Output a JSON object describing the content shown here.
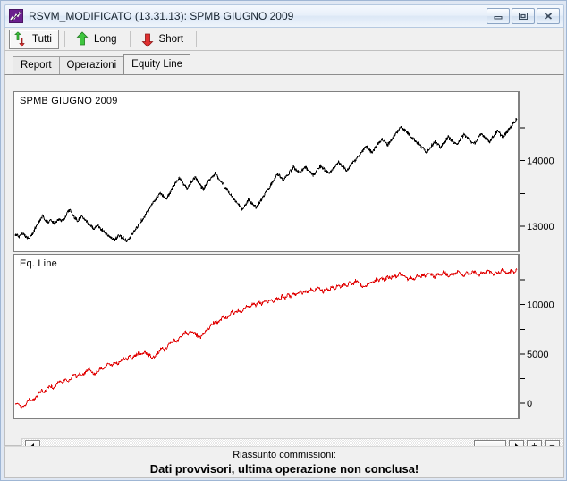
{
  "window": {
    "title": "RSVM_MODIFICATO (13.31.13): SPMB GIUGNO 2009",
    "app_icon": "line-chart-icon",
    "controls": {
      "minimize": "minimize-icon",
      "restore": "restore-icon",
      "close": "close-icon"
    }
  },
  "toolbar": {
    "buttons": [
      {
        "label": "Tutti",
        "icon": "up-down-arrow-icon",
        "active": true
      },
      {
        "label": "Long",
        "icon": "green-up-arrow-icon",
        "active": false
      },
      {
        "label": "Short",
        "icon": "red-down-arrow-icon",
        "active": false
      }
    ]
  },
  "tabs": [
    {
      "label": "Report",
      "selected": false
    },
    {
      "label": "Operazioni",
      "selected": false
    },
    {
      "label": "Equity Line",
      "selected": true
    }
  ],
  "scrollbar": {
    "left_arrow": "left-arrow-icon",
    "right_arrow": "right-arrow-icon",
    "zoom_in": "+",
    "zoom_out": "−"
  },
  "status": {
    "line1": "Riassunto commissioni:",
    "line2": "Dati provvisori, ultima operazione non conclusa!"
  },
  "colors": {
    "price_series": "#000000",
    "equity_series": "#e00000",
    "panel_bg": "#ffffff",
    "window_chrome": "#f0f0f0",
    "titlebar": "#e8f0fa"
  },
  "chart_data": [
    {
      "type": "line",
      "name": "price-chart",
      "title": "SPMB GIUGNO 2009",
      "xlabel": "",
      "ylabel": "",
      "ylim": [
        12700,
        14800
      ],
      "yticks": [
        13000,
        13500,
        14000,
        14500
      ],
      "ytick_labels": [
        "13000",
        "",
        "14000",
        ""
      ],
      "grid": false,
      "legend": "none",
      "series": [
        {
          "name": "SPMB GIUGNO 2009",
          "color": "#000000",
          "values": [
            12870,
            12860,
            12845,
            12880,
            12900,
            12855,
            12830,
            12815,
            12840,
            12900,
            12960,
            13010,
            13060,
            13110,
            13150,
            13120,
            13080,
            13060,
            13090,
            13070,
            13050,
            13080,
            13110,
            13100,
            13090,
            13120,
            13160,
            13220,
            13270,
            13180,
            13140,
            13110,
            13090,
            13120,
            13150,
            13110,
            13080,
            13050,
            13020,
            12990,
            12960,
            13000,
            13020,
            12980,
            12950,
            12930,
            12900,
            12870,
            12845,
            12820,
            12800,
            12790,
            12830,
            12860,
            12840,
            12820,
            12800,
            12780,
            12800,
            12850,
            12890,
            12930,
            12980,
            13020,
            13070,
            13110,
            13150,
            13200,
            13240,
            13290,
            13340,
            13380,
            13420,
            13470,
            13510,
            13480,
            13440,
            13400,
            13460,
            13510,
            13570,
            13620,
            13660,
            13700,
            13740,
            13690,
            13640,
            13600,
            13570,
            13620,
            13680,
            13720,
            13750,
            13700,
            13650,
            13600,
            13560,
            13610,
            13660,
            13700,
            13740,
            13770,
            13800,
            13760,
            13720,
            13680,
            13640,
            13600,
            13560,
            13520,
            13480,
            13440,
            13400,
            13360,
            13320,
            13290,
            13250,
            13300,
            13350,
            13400,
            13370,
            13340,
            13310,
            13280,
            13330,
            13380,
            13420,
            13470,
            13510,
            13560,
            13610,
            13660,
            13710,
            13760,
            13800,
            13760,
            13720,
            13700,
            13740,
            13780,
            13820,
            13860,
            13900,
            13870,
            13840,
            13810,
            13840,
            13880,
            13910,
            13870,
            13840,
            13810,
            13780,
            13810,
            13850,
            13890,
            13920,
            13890,
            13860,
            13830,
            13800,
            13830,
            13870,
            13910,
            13940,
            13970,
            13940,
            13910,
            13880,
            13850,
            13880,
            13920,
            13960,
            13990,
            14020,
            14060,
            14100,
            14140,
            14180,
            14220,
            14190,
            14160,
            14130,
            14170,
            14210,
            14250,
            14290,
            14330,
            14300,
            14270,
            14240,
            14280,
            14320,
            14360,
            14400,
            14440,
            14480,
            14520,
            14490,
            14460,
            14430,
            14400,
            14370,
            14340,
            14310,
            14280,
            14250,
            14220,
            14190,
            14160,
            14130,
            14170,
            14210,
            14250,
            14290,
            14260,
            14230,
            14200,
            14240,
            14280,
            14320,
            14360,
            14330,
            14300,
            14270,
            14240,
            14280,
            14320,
            14360,
            14400,
            14370,
            14340,
            14310,
            14280,
            14250,
            14290,
            14330,
            14370,
            14410,
            14380,
            14350,
            14320,
            14290,
            14330,
            14370,
            14410,
            14450,
            14420,
            14390,
            14360,
            14400,
            14440,
            14480,
            14520,
            14560,
            14600,
            14640
          ]
        }
      ]
    },
    {
      "type": "line",
      "name": "equity-line-chart",
      "title": "Eq. Line",
      "xlabel": "",
      "ylabel": "",
      "ylim": [
        -900,
        13600
      ],
      "yticks": [
        0,
        2500,
        5000,
        7500,
        10000,
        12500
      ],
      "ytick_labels": [
        "0",
        "",
        "5000",
        "",
        "10000",
        ""
      ],
      "grid": false,
      "legend": "none",
      "series": [
        {
          "name": "Eq. Line",
          "color": "#e00000",
          "values": [
            0,
            -150,
            -400,
            -250,
            100,
            380,
            250,
            600,
            980,
            1320,
            1100,
            1450,
            1800,
            1600,
            1900,
            2250,
            2050,
            2400,
            2200,
            2550,
            2900,
            2700,
            3050,
            2850,
            3200,
            3550,
            3300,
            2900,
            3250,
            3600,
            3400,
            3750,
            4050,
            3850,
            4200,
            4000,
            4350,
            4600,
            4400,
            4750,
            4500,
            4850,
            5100,
            4900,
            5250,
            5050,
            4800,
            4550,
            4900,
            5250,
            5600,
            5400,
            5750,
            6100,
            6400,
            6200,
            6550,
            6900,
            7200,
            7000,
            7350,
            7100,
            6850,
            6600,
            6900,
            7250,
            7600,
            7950,
            8300,
            8100,
            8450,
            8800,
            8600,
            8950,
            9300,
            9100,
            9450,
            9250,
            9600,
            9950,
            9750,
            10100,
            9900,
            10250,
            10050,
            10400,
            10200,
            10550,
            10350,
            10700,
            10500,
            10850,
            10650,
            11000,
            10800,
            11150,
            10950,
            11300,
            11100,
            11450,
            11250,
            11600,
            11400,
            11750,
            11550,
            11300,
            11650,
            11450,
            11800,
            11600,
            11950,
            11750,
            12100,
            11900,
            12250,
            12050,
            12400,
            12200,
            11950,
            11700,
            12050,
            12400,
            12200,
            12550,
            12350,
            12700,
            12500,
            12850,
            12650,
            13000,
            12800,
            13150,
            12950,
            12700,
            12450,
            12800,
            12600,
            12950,
            12750,
            13100,
            12900,
            13250,
            13050,
            12800,
            13150,
            12950,
            13300,
            13100,
            12850,
            13200,
            13000,
            13350,
            13150,
            12900,
            13250,
            13050,
            13400,
            13200,
            12950,
            13300,
            13100,
            13450,
            13250,
            13000,
            13350,
            13150,
            13500,
            13300,
            13050,
            13400,
            13200,
            13550
          ]
        }
      ]
    }
  ]
}
